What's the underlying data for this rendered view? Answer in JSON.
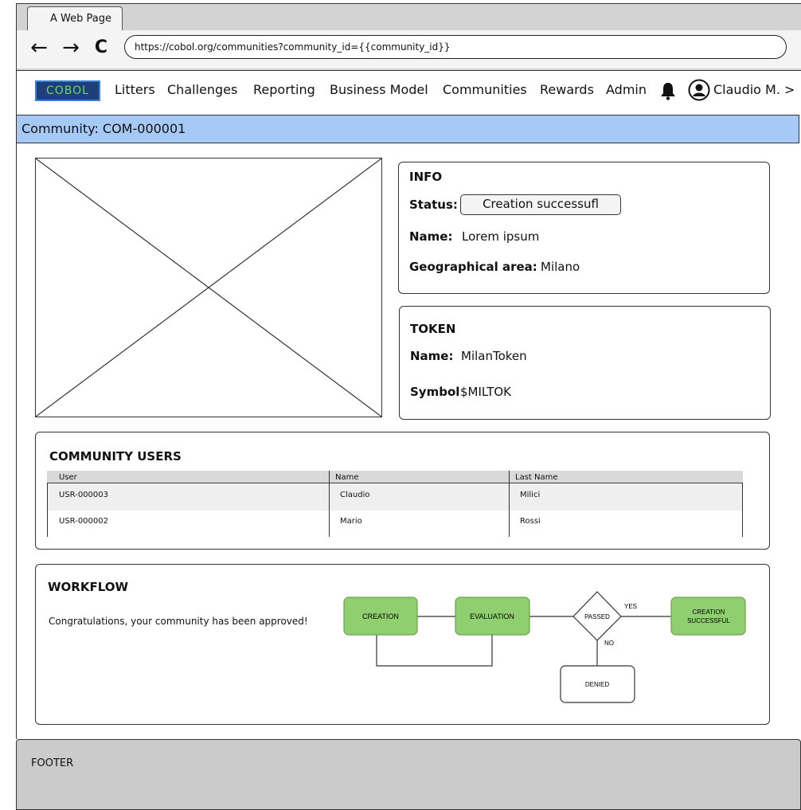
{
  "browser": {
    "tab_title": "A Web Page",
    "url": "https://cobol.org/communities?community_id={{community_id}}",
    "back": "←",
    "forward": "→",
    "reload": "C"
  },
  "nav": {
    "logo_text": "COBOL",
    "items": [
      "Litters",
      "Challenges",
      "Reporting",
      "Business Model",
      "Communities",
      "Rewards",
      "Admin"
    ],
    "user": "Claudio M. >"
  },
  "page": {
    "title": "Community: COM-000001"
  },
  "info": {
    "heading": "INFO",
    "status_label": "Status:",
    "status_value": "Creation successufl",
    "name_label": "Name:",
    "name_value": "Lorem ipsum",
    "area_label": "Geographical area:",
    "area_value": "Milano"
  },
  "token": {
    "heading": "TOKEN",
    "name_label": "Name:",
    "name_value": "MilanToken",
    "symbol_label": "Symbol",
    "symbol_value": "$MILTOK"
  },
  "users": {
    "heading": "COMMUNITY USERS",
    "columns": [
      "User",
      "Name",
      "Last Name"
    ],
    "rows": [
      [
        "USR-000003",
        "Claudio",
        "Milici"
      ],
      [
        "USR-000002",
        "Mario",
        "Rossi"
      ]
    ]
  },
  "workflow": {
    "heading": "WORKFLOW",
    "message": "Congratulations, your community has been approved!",
    "nodes": {
      "creation": "CREATION",
      "evaluation": "EVALUATION",
      "passed": "PASSED",
      "success_1": "CREATION",
      "success_2": "SUCCESSFUL",
      "denied": "DENIED"
    },
    "yes": "YES",
    "no": "NO"
  },
  "footer": {
    "text": "FOOTER"
  },
  "colors": {
    "title_bar": "#a6c9f5",
    "node_green": "#8fcf6f",
    "logo_bg": "#1e3f7a"
  }
}
